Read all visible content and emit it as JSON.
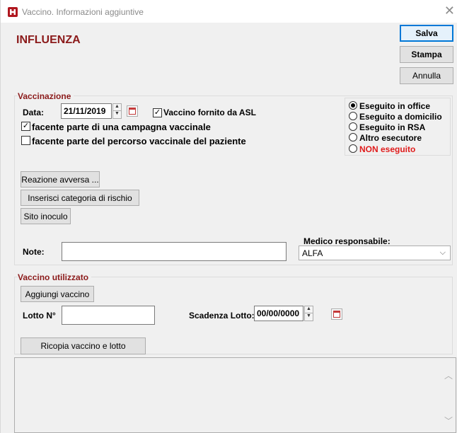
{
  "window": {
    "title": "Vaccino. Informazioni aggiuntive",
    "close_icon": "close-icon"
  },
  "heading": "INFLUENZA",
  "actions": {
    "save": "Salva",
    "print": "Stampa",
    "cancel": "Annulla"
  },
  "vaccination": {
    "group_label": "Vaccinazione",
    "date_label": "Data:",
    "date_value": "21/11/2019",
    "asl_label": "Vaccino fornito da ASL",
    "asl_checked": true,
    "campaign_label": "facente parte di una campagna vaccinale",
    "campaign_checked": true,
    "path_label": "facente parte del percorso vaccinale del paziente",
    "path_checked": false,
    "executors": [
      {
        "label": "Eseguito in office",
        "selected": true
      },
      {
        "label": "Eseguito a domicilio",
        "selected": false
      },
      {
        "label": "Eseguito in RSA",
        "selected": false
      },
      {
        "label": "Altro esecutore",
        "selected": false
      },
      {
        "label": "NON eseguito",
        "selected": false,
        "color": "#e01b1b"
      }
    ],
    "adverse_button": "Reazione avversa ...",
    "risk_button": "Inserisci categoria di rischio",
    "site_button": "Sito inoculo",
    "notes_label": "Note:",
    "notes_value": "",
    "doctor_label": "Medico responsabile:",
    "doctor_value": "ALFA"
  },
  "vaccine_used": {
    "group_label": "Vaccino utilizzato",
    "add_button": "Aggiungi vaccino",
    "lot_label": "Lotto N°",
    "lot_value": "",
    "expiry_label": "Scadenza Lotto:",
    "expiry_value": "00/00/0000",
    "copy_button": "Ricopia vaccino e lotto"
  },
  "memo": {
    "value": ""
  },
  "colors": {
    "heading": "#8b1a1a",
    "accent": "#0078d7",
    "red": "#e01b1b"
  }
}
